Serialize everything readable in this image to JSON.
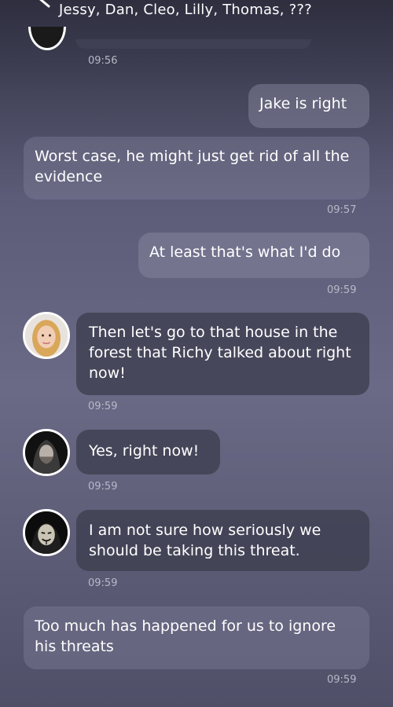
{
  "header": {
    "title": "Jessy, Dan, Cleo, Lilly, Thomas, ???"
  },
  "messages": [
    {
      "time": "09:56"
    },
    {
      "text": "Jake is right"
    },
    {
      "text": "Worst case, he might just get rid of all the evidence",
      "time": "09:57"
    },
    {
      "text": "At least that's what I'd do",
      "time": "09:59"
    },
    {
      "text": "Then let's go to that house in the forest that Richy talked about right now!",
      "time": "09:59",
      "avatar": "blonde-woman-avatar"
    },
    {
      "text": "Yes, right now!",
      "time": "09:59",
      "avatar": "hooded-man-avatar"
    },
    {
      "text": "I am not sure how seriously we should be taking this threat.",
      "time": "09:59",
      "avatar": "anonymous-mask-avatar"
    },
    {
      "text": "Too much has happened for us to ignore his threats",
      "time": "09:59"
    }
  ],
  "colors": {
    "bubble_outgoing": "#8c8ca5",
    "bubble_dark": "#3c3c4e",
    "timestamp": "#b8b8c8"
  }
}
